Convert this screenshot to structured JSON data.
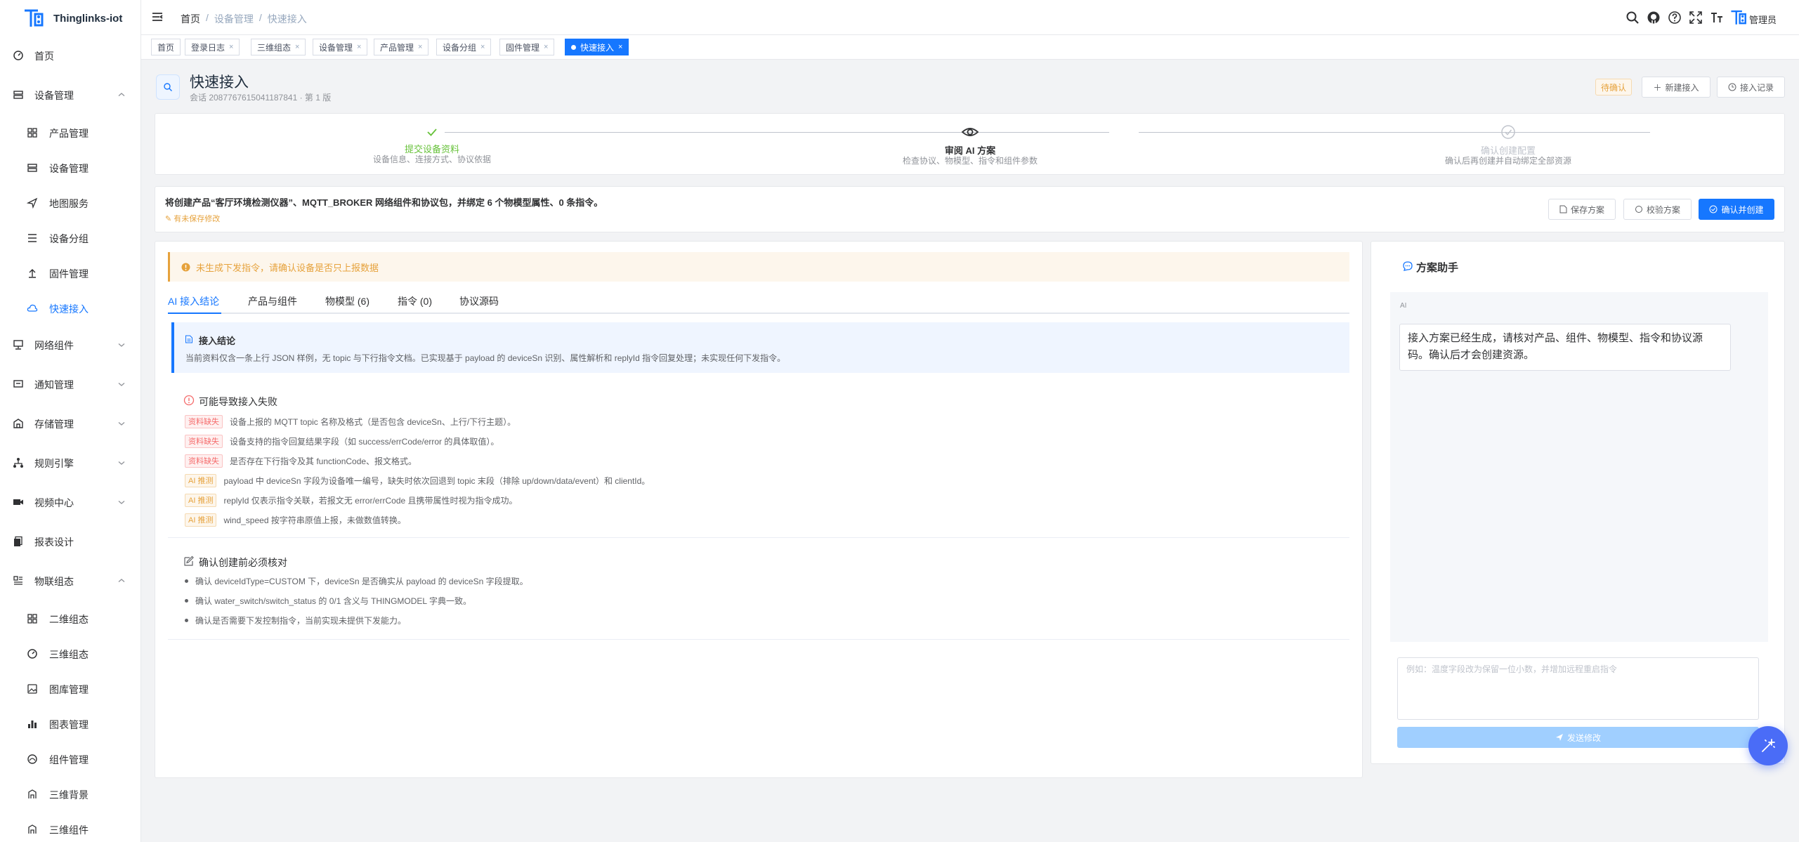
{
  "app": {
    "name": "Thinglinks-iot"
  },
  "sidebar": {
    "items": [
      {
        "label": "首页",
        "icon": "dashboard-icon"
      },
      {
        "label": "设备管理",
        "icon": "device-icon"
      },
      {
        "label": "产品管理",
        "icon": "grid-icon"
      },
      {
        "label": "设备管理",
        "icon": "device-icon"
      },
      {
        "label": "地图服务",
        "icon": "send-icon"
      },
      {
        "label": "设备分组",
        "icon": "list-icon"
      },
      {
        "label": "固件管理",
        "icon": "upload-icon"
      },
      {
        "label": "快速接入",
        "icon": "cloud-icon"
      },
      {
        "label": "网络组件",
        "icon": "network-icon"
      },
      {
        "label": "通知管理",
        "icon": "message-icon"
      },
      {
        "label": "存储管理",
        "icon": "storage-icon"
      },
      {
        "label": "规则引擎",
        "icon": "rules-icon"
      },
      {
        "label": "视频中心",
        "icon": "video-icon"
      },
      {
        "label": "报表设计",
        "icon": "report-icon"
      },
      {
        "label": "物联组态",
        "icon": "config-icon"
      },
      {
        "label": "二维组态",
        "icon": "grid-icon"
      },
      {
        "label": "三维组态",
        "icon": "dashboard-icon"
      },
      {
        "label": "图库管理",
        "icon": "image-icon"
      },
      {
        "label": "图表管理",
        "icon": "bar-chart-icon"
      },
      {
        "label": "组件管理",
        "icon": "component-icon"
      },
      {
        "label": "三维背景",
        "icon": "background-icon"
      },
      {
        "label": "三维组件",
        "icon": "background-icon"
      }
    ]
  },
  "header": {
    "breadcrumb": [
      "首页",
      "设备管理",
      "快速接入"
    ],
    "admin_name": "管理员"
  },
  "tags": [
    {
      "label": "首页"
    },
    {
      "label": "登录日志"
    },
    {
      "label": "三维组态"
    },
    {
      "label": "设备管理"
    },
    {
      "label": "产品管理"
    },
    {
      "label": "设备分组"
    },
    {
      "label": "固件管理"
    },
    {
      "label": "快速接入"
    }
  ],
  "page": {
    "title": "快速接入",
    "subtitle": "会话 2087767615041187841 · 第 1 版",
    "status": "待确认",
    "new_btn": "新建接入",
    "history_btn": "接入记录"
  },
  "steps": [
    {
      "title": "提交设备资料",
      "desc": "设备信息、连接方式、协议依据",
      "state": "done"
    },
    {
      "title": "审阅 AI 方案",
      "desc": "检查协议、物模型、指令和组件参数",
      "state": "current"
    },
    {
      "title": "确认创建配置",
      "desc": "确认后再创建并自动绑定全部资源",
      "state": "wait"
    }
  ],
  "summary": {
    "text": "将创建产品“客厅环境检测仪器”、MQTT_BROKER 网络组件和协议包，并绑定 6 个物模型属性、0 条指令。",
    "unsaved": "有未保存修改",
    "save_btn": "保存方案",
    "validate_btn": "校验方案",
    "confirm_btn": "确认并创建"
  },
  "main": {
    "warning": "未生成下发指令，请确认设备是否只上报数据",
    "tabs": [
      "AI 接入结论",
      "产品与组件",
      "物模型 (6)",
      "指令 (0)",
      "协议源码"
    ],
    "conclusion_title": "接入结论",
    "conclusion_body": "当前资料仅含一条上行 JSON 样例，无 topic 与下行指令文档。已实现基于 payload 的 deviceSn 识别、属性解析和 replyId 指令回复处理；未实现任何下发指令。",
    "risks_title": "可能导致接入失败",
    "risks": [
      {
        "tag": "资料缺失",
        "type": "miss",
        "text": "设备上报的 MQTT topic 名称及格式（是否包含 deviceSn、上行/下行主题）。"
      },
      {
        "tag": "资料缺失",
        "type": "miss",
        "text": "设备支持的指令回复结果字段（如 success/errCode/error 的具体取值）。"
      },
      {
        "tag": "资料缺失",
        "type": "miss",
        "text": "是否存在下行指令及其 functionCode、报文格式。"
      },
      {
        "tag": "AI 推测",
        "type": "ai",
        "text": "payload 中 deviceSn 字段为设备唯一编号，缺失时依次回退到 topic 末段（排除 up/down/data/event）和 clientId。"
      },
      {
        "tag": "AI 推测",
        "type": "ai",
        "text": "replyId 仅表示指令关联，若报文无 error/errCode 且携带属性时视为指令成功。"
      },
      {
        "tag": "AI 推测",
        "type": "ai",
        "text": "wind_speed 按字符串原值上报，未做数值转换。"
      }
    ],
    "checks_title": "确认创建前必须核对",
    "checks": [
      "确认 deviceIdType=CUSTOM 下，deviceSn 是否确实从 payload 的 deviceSn 字段提取。",
      "确认 water_switch/switch_status 的 0/1 含义与 THINGMODEL 字典一致。",
      "确认是否需要下发控制指令，当前实现未提供下发能力。"
    ]
  },
  "assistant": {
    "title": "方案助手",
    "ai_label": "AI",
    "message": "接入方案已经生成，请核对产品、组件、物模型、指令和协议源码。确认后才会创建资源。",
    "input_placeholder": "例如：温度字段改为保留一位小数，并增加远程重启指令",
    "send_btn": "发送修改"
  },
  "colors": {
    "primary": "#1677ff",
    "success": "#67c23a",
    "warning": "#e6a23c",
    "danger": "#f56c6c"
  }
}
